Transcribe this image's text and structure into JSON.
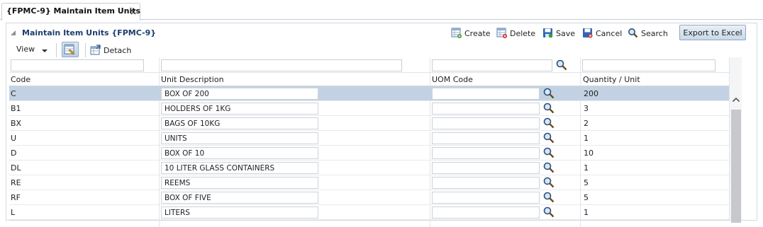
{
  "tab": {
    "title": "{FPMC-9} Maintain Item Units",
    "close": "×"
  },
  "panel": {
    "title": "Maintain Item Units {FPMC-9}"
  },
  "toolbar": {
    "create": "Create",
    "delete": "Delete",
    "save": "Save",
    "cancel": "Cancel",
    "search": "Search",
    "export": "Export to Excel",
    "view": "View",
    "detach": "Detach"
  },
  "columns": {
    "code": "Code",
    "description": "Unit Description",
    "uom": "UOM Code",
    "qty": "Quantity / Unit"
  },
  "rows": [
    {
      "code": "C",
      "description": "BOX OF 200",
      "qty": "200",
      "selected": true
    },
    {
      "code": "B1",
      "description": "HOLDERS OF 1KG",
      "qty": "3"
    },
    {
      "code": "BX",
      "description": "BAGS OF 10KG",
      "qty": "2"
    },
    {
      "code": "U",
      "description": "UNITS",
      "qty": "1"
    },
    {
      "code": "D",
      "description": "BOX OF 10",
      "qty": "10"
    },
    {
      "code": "DL",
      "description": "10 LITER GLASS CONTAINERS",
      "qty": "1"
    },
    {
      "code": "RE",
      "description": "REEMS",
      "qty": "5"
    },
    {
      "code": "RF",
      "description": "BOX OF FIVE",
      "qty": "5"
    },
    {
      "code": "L",
      "description": "LITERS",
      "qty": "1"
    }
  ],
  "colors": {
    "selected_row": "#c3d2e3",
    "title": "#1b3f6b"
  },
  "icons": {
    "create": "create-icon",
    "delete": "delete-icon",
    "save": "save-icon",
    "cancel": "cancel-icon",
    "search": "magnifier-icon",
    "detach": "detach-icon",
    "qbe": "query-by-example-icon",
    "lookup": "magnifier-icon"
  }
}
